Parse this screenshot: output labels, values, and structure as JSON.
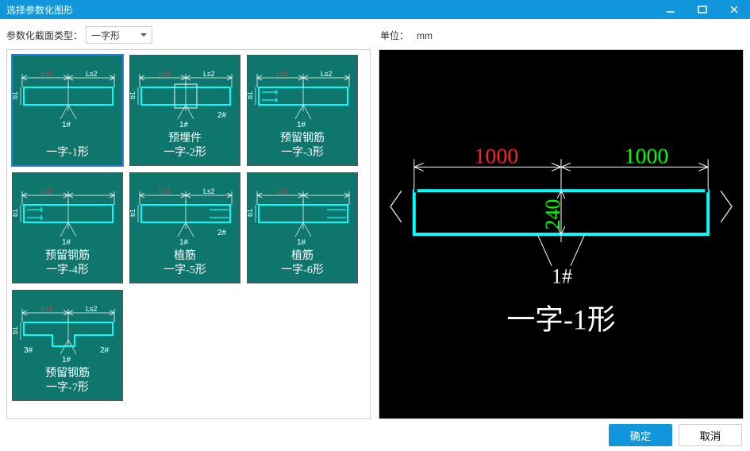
{
  "window_title": "选择参数化图形",
  "toolbar": {
    "type_label": "参数化截面类型：",
    "type_value": "一字形",
    "unit_label": "单位：",
    "unit_value": "mm"
  },
  "tiles": [
    {
      "id": "t1",
      "caption": "一字-1形",
      "selected": true,
      "dim_ls1": "Ls1",
      "dim_ls2": "Ls2",
      "dim_b1": "b1",
      "mark": "1#"
    },
    {
      "id": "t2",
      "caption": "预埋件\n一字-2形",
      "dim_ls1": "Ls1",
      "dim_ls2": "Ls2",
      "dim_b1": "b1",
      "mark": "1#",
      "mark2": "2#"
    },
    {
      "id": "t3",
      "caption": "预留钢筋\n一字-3形",
      "dim_ls1": "Ls1",
      "dim_ls2": "Ls2",
      "dim_b1": "b1",
      "mark": "1#"
    },
    {
      "id": "t4",
      "caption": "预留钢筋\n一字-4形",
      "dim_ls1": "Ls1",
      "dim_b1": "b1",
      "mark": "1#"
    },
    {
      "id": "t5",
      "caption": "植筋\n一字-5形",
      "dim_ls1": "Ls1",
      "dim_ls2": "Ls2",
      "dim_b1": "b1",
      "mark": "1#",
      "mark2": "2#"
    },
    {
      "id": "t6",
      "caption": "植筋\n一字-6形",
      "dim_ls1": "Ls1",
      "dim_b1": "b1",
      "mark": "1#"
    },
    {
      "id": "t7",
      "caption": "预留钢筋\n一字-7形",
      "dim_ls1": "Ls1",
      "dim_ls2": "Ls2",
      "dim_b1": "b1",
      "mark": "1#",
      "mark2": "2#",
      "mark3": "3#"
    }
  ],
  "preview": {
    "left_dim": "1000",
    "right_dim": "1000",
    "height_dim": "240",
    "mark": "1#",
    "title": "一字-1形"
  },
  "buttons": {
    "ok": "确定",
    "cancel": "取消"
  }
}
